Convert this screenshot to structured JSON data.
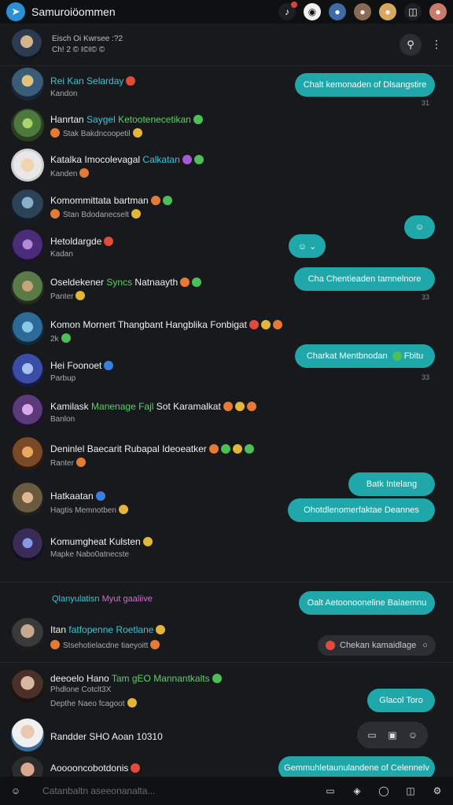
{
  "app": {
    "title": "Samuroiöommen",
    "logo_icon": "paper-plane-icon"
  },
  "topbar_icons": [
    "music-note-icon",
    "shield-icon",
    "avatar-group-icon",
    "avatar-icon",
    "avatar-icon",
    "gamepad-icon",
    "avatar-icon"
  ],
  "header": {
    "line1": "Eisch Oi Kwrsee :?2",
    "line2": "Ch! 2 © I©I© ©"
  },
  "chats": [
    {
      "name_a": "Rei Kan Selarday",
      "name_b": "",
      "sub": "Kandon",
      "time": ""
    },
    {
      "name_a": "Hanrtan",
      "name_b": "Saygel",
      "name_c": "Ketootenecetikan",
      "sub": "Stak Bakdncoopetil",
      "time": ""
    },
    {
      "name_a": "Katalka Imocolevagal",
      "name_b": "Calkatan",
      "sub": "Kanden",
      "time": ""
    },
    {
      "name_a": "Komommittata bartman",
      "name_b": "",
      "sub": "Stan Bdodanecselt",
      "time": ""
    },
    {
      "name_a": "Hetoldargde",
      "name_b": "",
      "sub": "Kadan",
      "time": ""
    },
    {
      "name_a": "Oseldekener",
      "name_b": "Syncs",
      "name_c": "Natnaayth",
      "sub": "Panter",
      "time": ""
    },
    {
      "name_a": "Komon Mornert Thangbant Hangblika Fonbigat",
      "name_b": "",
      "sub": "2k",
      "time": ""
    },
    {
      "name_a": "Hei Foonoet",
      "name_b": "",
      "sub": "Parbup",
      "time": ""
    },
    {
      "name_a": "Kamilask",
      "name_b": "Manenage Fajl",
      "name_c": "Sot Karamalkat",
      "sub": "Banlon",
      "time": ""
    },
    {
      "name_a": "Deninlel Baecarit",
      "name_b": "Rubapal Ideoeatker",
      "sub": "Ranter",
      "time": ""
    },
    {
      "name_a": "Hatkaatan",
      "name_b": "",
      "sub": "Hagtis Memnotben",
      "time": ""
    },
    {
      "name_a": "Komumgheat Kulsten",
      "name_b": "",
      "sub": "Mapke Nabo0atnecste",
      "time": ""
    }
  ],
  "bubbles": [
    {
      "text": "Chalt kemonaden of Dlsangstire",
      "time": "31"
    },
    {
      "text": ""
    },
    {
      "text": ""
    },
    {
      "text": "Cha Chentieaden tamnelnore",
      "time": "33"
    },
    {
      "text": "Charkat Mentbnodan",
      "tail": "Fbitu",
      "time": "33"
    },
    {
      "text": "Batk Intelang"
    },
    {
      "text": "Ohotdlenomerfaktae Deannes"
    }
  ],
  "section": {
    "label_a": "Qlanyulatisn",
    "label_b": "Myut",
    "label_c": "gaaliive"
  },
  "section_chats": [
    {
      "name_a": "Itan",
      "name_b": "fatfopenne Roetlane",
      "sub": "Stsehotielacdne tiaeyoitt"
    },
    {
      "name_a": "deeoelo Hano",
      "name_b": "Tam gEO Mannantkalts",
      "sub_a": "Phdlone Cotclt3X",
      "sub_b": "Depthe Naeo fcagoot"
    },
    {
      "name_a": "Randder SHO Aoan 10310",
      "name_b": ""
    },
    {
      "name_a": "Aooooncobotdonis",
      "name_b": ""
    }
  ],
  "section_bubbles": [
    {
      "text": "Oalt Aetoonooneline Balaemnu"
    },
    {
      "text": "Chekan kamaidlage"
    },
    {
      "text": "Glacol Toro"
    },
    {
      "text": "Gemmuhletaunulandene of Celennelv"
    }
  ],
  "bottom": {
    "placeholder": "Catanbaltn aseeonanalta..."
  }
}
